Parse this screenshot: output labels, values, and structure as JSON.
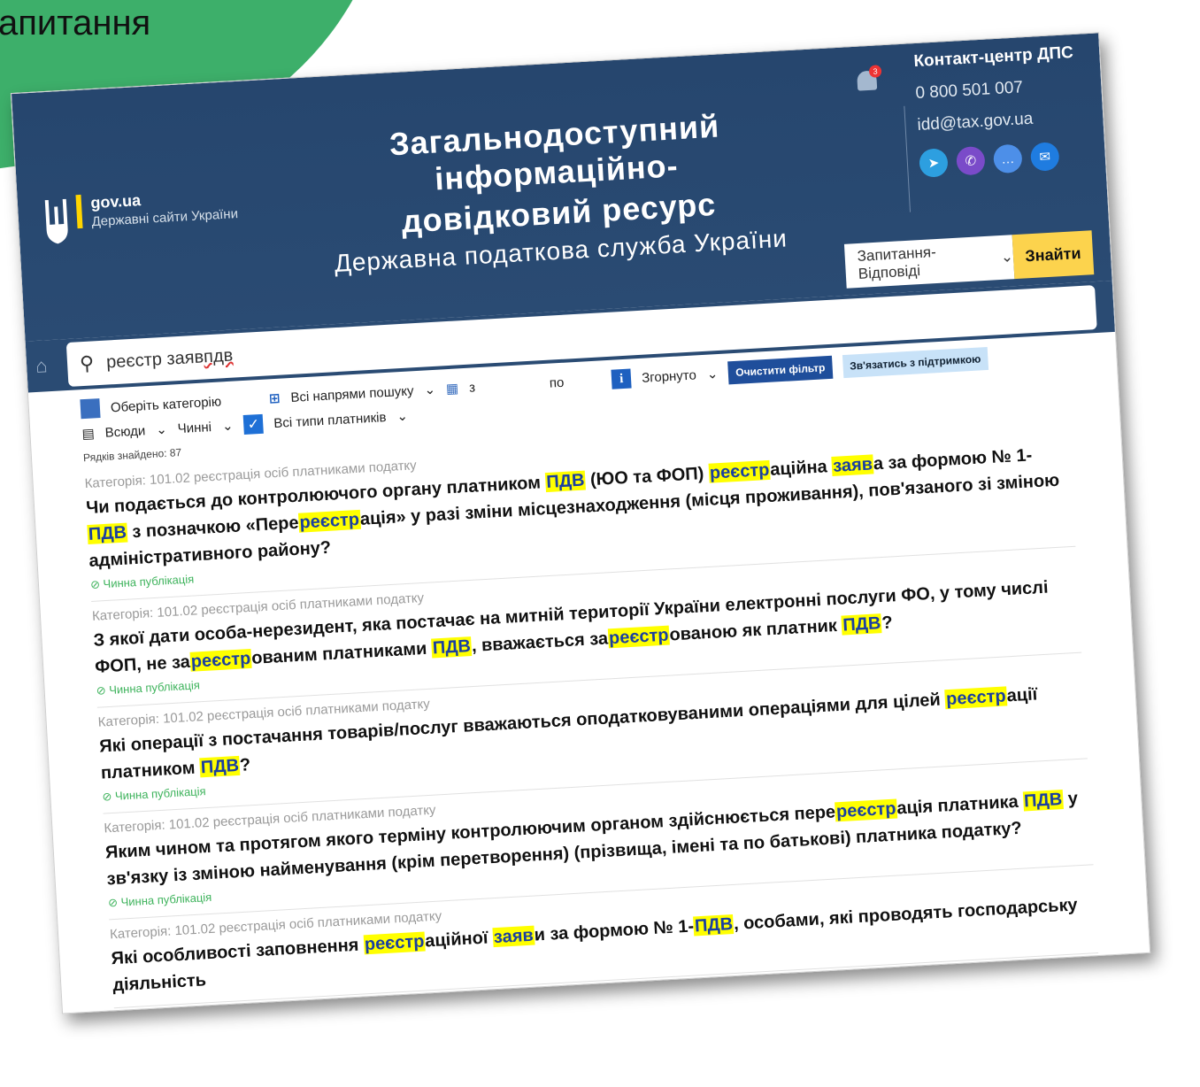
{
  "slide": {
    "title": "апитання"
  },
  "header": {
    "gov_title": "gov.ua",
    "gov_subtitle": "Державні сайти України",
    "site_title_1": "Загальнодоступний інформаційно-",
    "site_title_2": "довідковий ресурс",
    "site_subtitle": "Державна податкова служба України",
    "notif_count": "3",
    "contact_title": "Контакт-центр ДПС",
    "phone": "0 800 501 007",
    "email": "idd@tax.gov.ua",
    "search_type": "Запитання-Відповіді",
    "search_button": "Знайти"
  },
  "search": {
    "query_prefix": "реєстр заяв ",
    "query_marked": "пдв"
  },
  "filters": {
    "category": "Оберіть категорію",
    "scope": "Всюди",
    "state": "Чинні",
    "payer_types": "Всі типи платників",
    "directions": "Всі напрями пошуку",
    "date_from": "з",
    "date_to": "по",
    "view_mode": "Згорнуто",
    "clear": "Очистити фільтр",
    "support": "Зв'язатись з підтримкою"
  },
  "found_label": "Рядків знайдено: 87",
  "results": [
    {
      "cat": "Категорія: 101.02 реєстрація осіб платниками податку",
      "status": "Чинна публікація",
      "q": [
        "Чи подається до контролюючого органу платником ",
        "ПДВ",
        " (ЮО та ФОП) ",
        "реєстр",
        "аційна ",
        "заяв",
        "а за формою № 1-",
        "ПДВ",
        " з позначкою «Пере",
        "реєстр",
        "ація» у разі зміни місцезнаходження (місця проживання), пов'язаного зі зміною адміністративного району?"
      ]
    },
    {
      "cat": "Категорія: 101.02 реєстрація осіб платниками податку",
      "status": "Чинна публікація",
      "q": [
        "З якої дати особа-нерезидент, яка постачає на митній території України електронні послуги ФО, у тому числі ФОП, не за",
        "реєстр",
        "ованим платниками ",
        "ПДВ",
        ", вважається за",
        "реєстр",
        "ованою як платник ",
        "ПДВ",
        "?"
      ]
    },
    {
      "cat": "Категорія: 101.02 реєстрація осіб платниками податку",
      "status": "Чинна публікація",
      "q": [
        "Які операції з постачання товарів/послуг вважаються оподатковуваними операціями для цілей ",
        "реєстр",
        "ації платником ",
        "ПДВ",
        "?"
      ]
    },
    {
      "cat": "Категорія: 101.02 реєстрація осіб платниками податку",
      "status": "Чинна публікація",
      "q": [
        "Яким чином та протягом якого терміну контролюючим органом здійснюється пере",
        "реєстр",
        "ація платника ",
        "ПДВ",
        " у зв'язку із зміною найменування (крім перетворення) (прізвища, імені та по батькові) платника податку?"
      ]
    },
    {
      "cat": "Категорія: 101.02 реєстрація осіб платниками податку",
      "status": "",
      "q": [
        "Які особливості заповнення ",
        "реєстр",
        "аційної ",
        "заяв",
        "и за формою № 1-",
        "ПДВ",
        ", особами, які проводять господарську діяльність"
      ]
    }
  ]
}
